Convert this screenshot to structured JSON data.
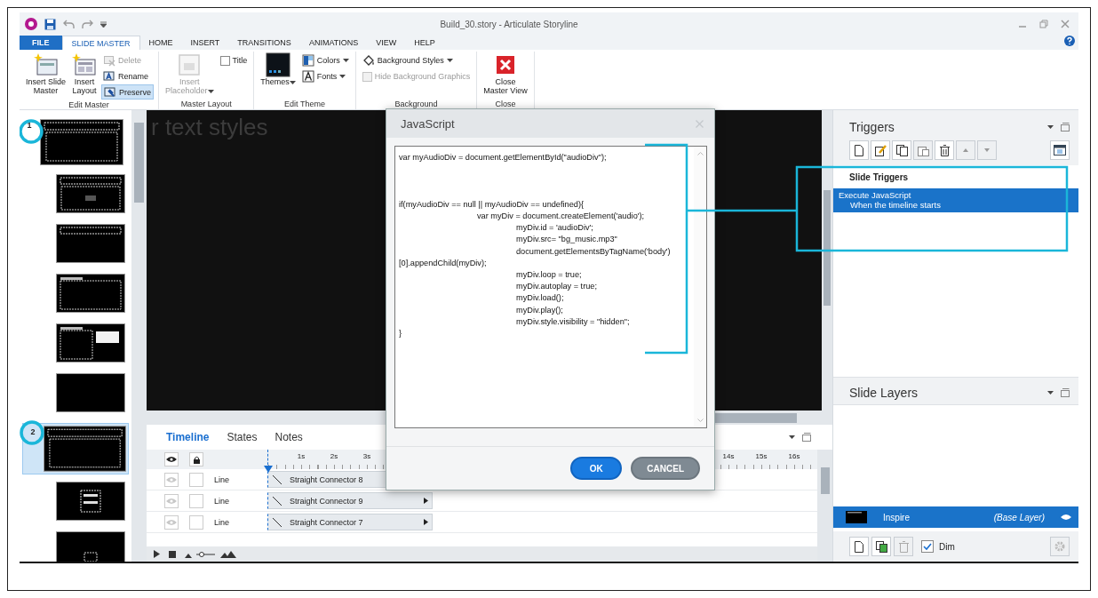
{
  "window": {
    "title": "Build_30.story - Articulate Storyline"
  },
  "ribbon_tabs": [
    {
      "label": "FILE",
      "kind": "file",
      "selected": false
    },
    {
      "label": "SLIDE MASTER",
      "kind": "tab",
      "selected": true
    },
    {
      "label": "HOME",
      "kind": "tab",
      "selected": false
    },
    {
      "label": "INSERT",
      "kind": "tab",
      "selected": false
    },
    {
      "label": "TRANSITIONS",
      "kind": "tab",
      "selected": false
    },
    {
      "label": "ANIMATIONS",
      "kind": "tab",
      "selected": false
    },
    {
      "label": "VIEW",
      "kind": "tab",
      "selected": false
    },
    {
      "label": "HELP",
      "kind": "tab",
      "selected": false
    }
  ],
  "ribbon_groups": [
    {
      "label": "Edit Master",
      "items": [
        {
          "kind": "large",
          "label": "Insert Slide\nMaster",
          "disabled": false,
          "selected": false,
          "dropdown": false
        },
        {
          "kind": "large",
          "label": "Insert\nLayout",
          "disabled": false,
          "selected": false,
          "dropdown": false
        },
        {
          "kind": "stack",
          "items": [
            {
              "kind": "small",
              "label": "Delete",
              "disabled": true,
              "selected": false,
              "dropdown": false
            },
            {
              "kind": "small",
              "label": "Rename",
              "disabled": false,
              "selected": false,
              "dropdown": false
            },
            {
              "kind": "small",
              "label": "Preserve",
              "disabled": false,
              "selected": true,
              "dropdown": false
            }
          ]
        }
      ]
    },
    {
      "label": "Master Layout",
      "items": [
        {
          "kind": "large",
          "label": "Insert\nPlaceholder",
          "disabled": true,
          "selected": false,
          "dropdown": true
        },
        {
          "kind": "stack",
          "items": [
            {
              "kind": "check",
              "label": "Title",
              "disabled": false,
              "checked": false
            }
          ]
        }
      ]
    },
    {
      "label": "Edit Theme",
      "items": [
        {
          "kind": "large",
          "label": "Themes",
          "disabled": false,
          "selected": false,
          "dropdown": true
        },
        {
          "kind": "stack",
          "items": [
            {
              "kind": "small",
              "label": "Colors",
              "disabled": false,
              "selected": false,
              "dropdown": true
            },
            {
              "kind": "small",
              "label": "Fonts",
              "disabled": false,
              "selected": false,
              "dropdown": true
            }
          ]
        }
      ]
    },
    {
      "label": "Background",
      "items": [
        {
          "kind": "stack",
          "items": [
            {
              "kind": "small",
              "label": "Background Styles",
              "disabled": false,
              "selected": false,
              "dropdown": true
            },
            {
              "kind": "check",
              "label": "Hide Background Graphics",
              "disabled": true,
              "checked": false
            }
          ]
        }
      ]
    },
    {
      "label": "Close",
      "items": [
        {
          "kind": "large",
          "label": "Close\nMaster View",
          "disabled": false,
          "selected": false,
          "dropdown": false
        }
      ]
    }
  ],
  "slides": [
    {
      "kind": "master",
      "number": "1",
      "selected": false
    },
    {
      "kind": "title_content",
      "selected": false
    },
    {
      "kind": "title_only",
      "selected": false
    },
    {
      "kind": "heading",
      "selected": false
    },
    {
      "kind": "two_content",
      "selected": false
    },
    {
      "kind": "blank",
      "selected": false
    },
    {
      "kind": "master",
      "number": "2",
      "selected": true
    },
    {
      "kind": "title_slide",
      "selected": false
    },
    {
      "kind": "picture",
      "selected": false
    }
  ],
  "stage": {
    "text": "r text styles"
  },
  "timeline": {
    "tabs": [
      {
        "label": "Timeline",
        "selected": true
      },
      {
        "label": "States",
        "selected": false
      },
      {
        "label": "Notes",
        "selected": false
      }
    ],
    "ruler": [
      "1s",
      "2s",
      "3s",
      "14s",
      "15s",
      "16s"
    ],
    "rows": [
      {
        "type": "Line",
        "name": "Straight Connector 8",
        "locked": false
      },
      {
        "type": "Line",
        "name": "Straight Connector 9",
        "locked": false
      },
      {
        "type": "Line",
        "name": "Straight Connector 7",
        "locked": false
      }
    ]
  },
  "triggers": {
    "title": "Triggers",
    "section": "Slide Triggers",
    "items": [
      {
        "action": "Execute JavaScript",
        "condition": "When the timeline starts",
        "selected": true
      }
    ]
  },
  "layers": {
    "title": "Slide Layers",
    "items": [
      {
        "name": "Inspire",
        "note": "(Base Layer)",
        "selected": true
      }
    ],
    "dim": {
      "label": "Dim",
      "checked": true
    }
  },
  "dialog": {
    "title": "JavaScript",
    "code": "var myAudioDiv = document.getElementById(\"audioDiv\");\n\n\n\nif(myAudioDiv == null || myAudioDiv == undefined){\n\t\tvar myDiv = document.createElement('audio');\n\t\t\tmyDiv.id = 'audioDiv';\n\t\t\tmyDiv.src= \"bg_music.mp3\"\n\t\t\tdocument.getElementsByTagName('body')\n[0].appendChild(myDiv);\n\t\t\tmyDiv.loop = true;\n\t\t\tmyDiv.autoplay = true;\n\t\t\tmyDiv.load();\n\t\t\tmyDiv.play();\n\t\t\tmyDiv.style.visibility = \"hidden\";\n}",
    "buttons": [
      {
        "label": "OK",
        "kind": "primary"
      },
      {
        "label": "CANCEL",
        "kind": "secondary"
      }
    ]
  }
}
